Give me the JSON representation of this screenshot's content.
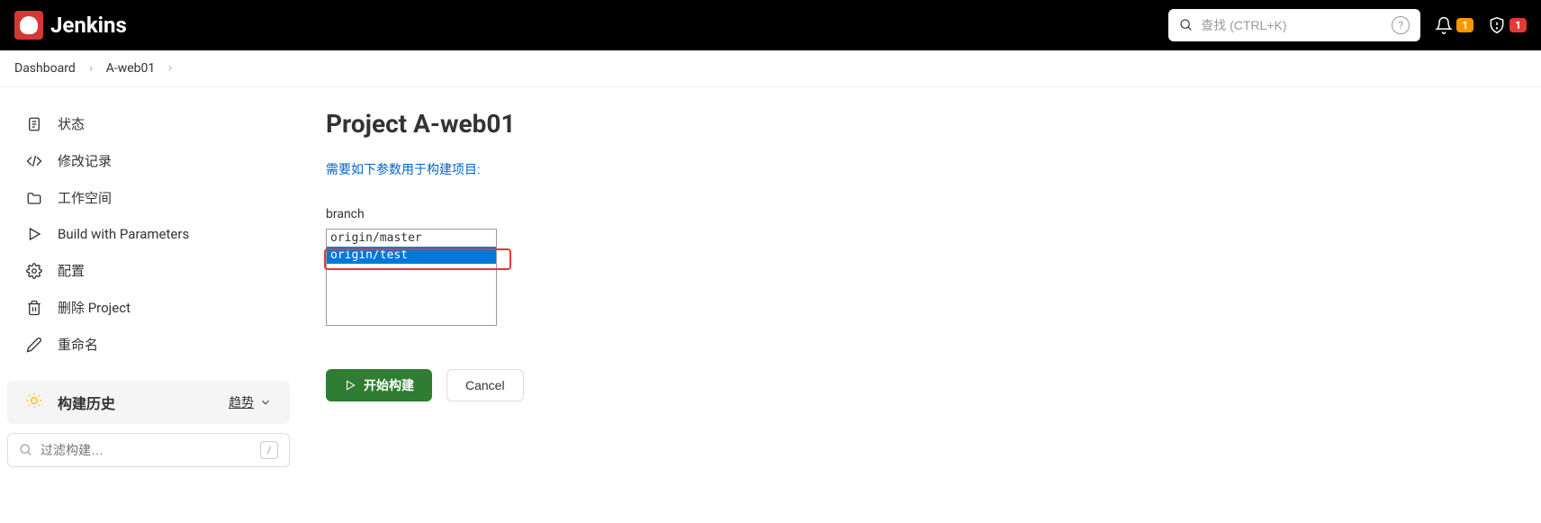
{
  "header": {
    "title": "Jenkins",
    "search_placeholder": "查找 (CTRL+K)",
    "notification_count": "1",
    "alert_count": "1"
  },
  "breadcrumb": {
    "items": [
      "Dashboard",
      "A-web01"
    ]
  },
  "sidebar": {
    "items": [
      {
        "label": "状态"
      },
      {
        "label": "修改记录"
      },
      {
        "label": "工作空间"
      },
      {
        "label": "Build with Parameters"
      },
      {
        "label": "配置"
      },
      {
        "label": "删除 Project"
      },
      {
        "label": "重命名"
      }
    ],
    "build_history": "构建历史",
    "trend": "趋势",
    "filter_placeholder": "过滤构建…",
    "filter_shortcut": "/"
  },
  "content": {
    "title": "Project A-web01",
    "params_text": "需要如下参数用于构建项目:",
    "param_label": "branch",
    "branch_options": [
      "origin/master",
      "origin/test"
    ],
    "selected_branch": "origin/test",
    "build_button": "开始构建",
    "cancel_button": "Cancel"
  }
}
